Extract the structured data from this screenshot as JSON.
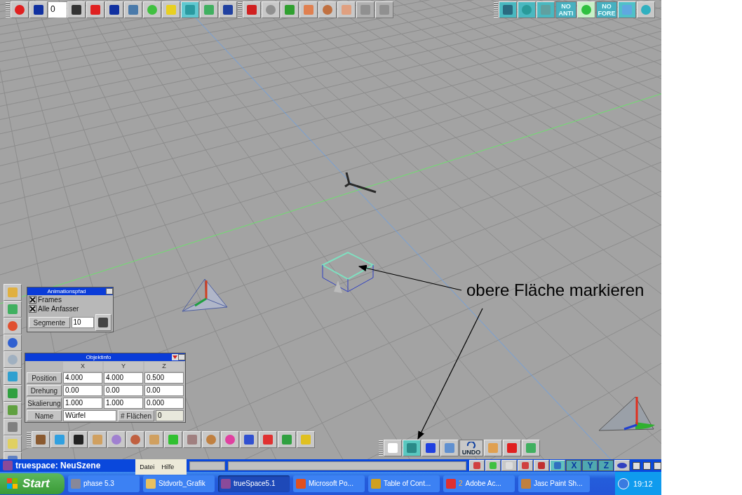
{
  "top_toolbar": {
    "frame_field": "0"
  },
  "render_toolbar": {
    "no_anti": "NO ANTI",
    "no_fore": "NO FORE"
  },
  "animation_path_panel": {
    "title": "Animationspfad",
    "options": [
      {
        "label": "Frames",
        "checked": true
      },
      {
        "label": "Alle Anfasser",
        "checked": true
      }
    ],
    "segments_label": "Segmente",
    "segments_value": "10"
  },
  "object_info_panel": {
    "title": "Objektinfo",
    "columns": [
      "X",
      "Y",
      "Z"
    ],
    "rows": [
      {
        "label": "Position",
        "values": [
          "4.000",
          "4.000",
          "0.500"
        ]
      },
      {
        "label": "Drehung",
        "values": [
          "0.00",
          "0.00",
          "0.00"
        ]
      },
      {
        "label": "Skalierung",
        "values": [
          "1.000",
          "1.000",
          "0.000"
        ]
      }
    ],
    "name_label": "Name",
    "name_value": "Würfel",
    "faces_label": "# Flächen",
    "faces_value": "0"
  },
  "edit_toolbar": {
    "undo_label": "UNDO"
  },
  "view_toolbar": {
    "axis_labels": [
      "X",
      "Y",
      "Z"
    ]
  },
  "title_bar": {
    "title": "truespace: NeuSzene",
    "menu": [
      "Datei",
      "Hilfe"
    ]
  },
  "taskbar": {
    "start": "Start",
    "items": [
      {
        "label": "phase 5.3",
        "selected": false
      },
      {
        "label": "Stdvorb_Grafik",
        "selected": false
      },
      {
        "label": "trueSpace5.1",
        "selected": true
      },
      {
        "label": "Microsoft Po...",
        "selected": false
      },
      {
        "label": "Table of Cont...",
        "selected": false
      },
      {
        "label": "Adobe Ac...",
        "count": "2",
        "selected": false
      },
      {
        "label": "Jasc Paint Sh...",
        "selected": false
      }
    ],
    "clock": "19:12"
  },
  "annotation": {
    "text": "obere Fläche markieren"
  }
}
